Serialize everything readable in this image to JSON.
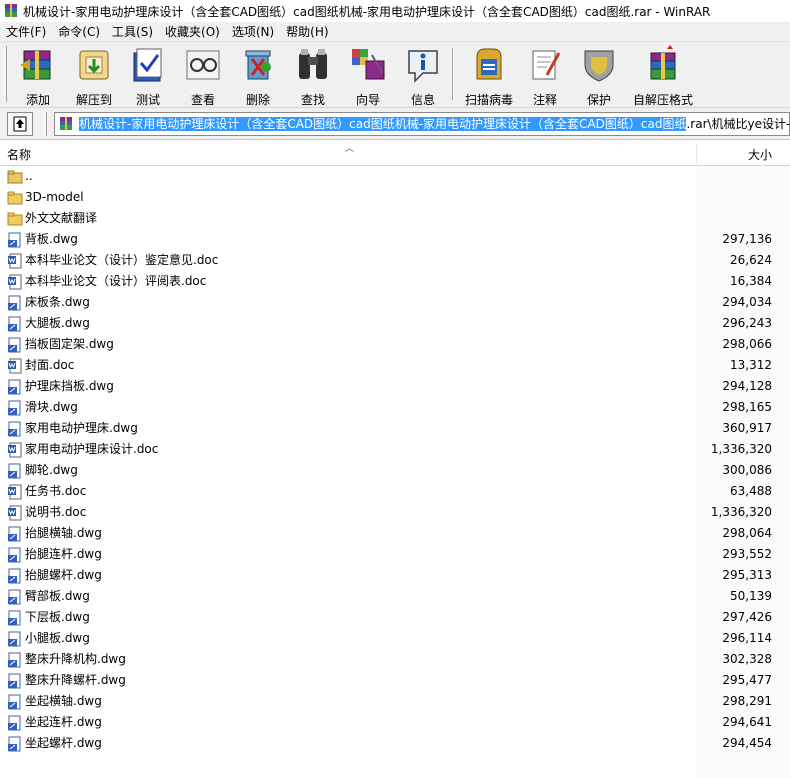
{
  "window": {
    "title": "机械设计-家用电动护理床设计（含全套CAD图纸）cad图纸机械-家用电动护理床设计（含全套CAD图纸）cad图纸.rar - WinRAR"
  },
  "menu": [
    {
      "label": "文件(F)"
    },
    {
      "label": "命令(C)"
    },
    {
      "label": "工具(S)"
    },
    {
      "label": "收藏夹(O)"
    },
    {
      "label": "选项(N)"
    },
    {
      "label": "帮助(H)"
    }
  ],
  "toolbar": [
    {
      "label": "添加",
      "icon": "add-archive-icon"
    },
    {
      "label": "解压到",
      "icon": "extract-to-icon"
    },
    {
      "label": "测试",
      "icon": "test-icon"
    },
    {
      "label": "查看",
      "icon": "view-icon"
    },
    {
      "label": "删除",
      "icon": "delete-icon"
    },
    {
      "label": "查找",
      "icon": "find-icon"
    },
    {
      "label": "向导",
      "icon": "wizard-icon"
    },
    {
      "label": "信息",
      "icon": "info-icon"
    },
    {
      "label": "扫描病毒",
      "icon": "scan-virus-icon"
    },
    {
      "label": "注释",
      "icon": "comment-icon"
    },
    {
      "label": "保护",
      "icon": "protect-icon"
    },
    {
      "label": "自解压格式",
      "icon": "sfx-icon"
    }
  ],
  "address": {
    "selected": "机械设计-家用电动护理床设计（含全套CAD图纸）cad图纸机械-家用电动护理床设计（含全套CAD图纸）cad图纸",
    "rest": ".rar\\机械比ye设计-家"
  },
  "columns": {
    "name": "名称",
    "size": "大小"
  },
  "files": [
    {
      "name": "..",
      "size": "",
      "type": "up"
    },
    {
      "name": "3D-model",
      "size": "",
      "type": "folder"
    },
    {
      "name": "外文文献翻译",
      "size": "",
      "type": "folder"
    },
    {
      "name": "背板.dwg",
      "size": "297,136",
      "type": "dwg"
    },
    {
      "name": "本科毕业论文（设计）鉴定意见.doc",
      "size": "26,624",
      "type": "doc"
    },
    {
      "name": "本科毕业论文（设计）评阅表.doc",
      "size": "16,384",
      "type": "doc"
    },
    {
      "name": "床板条.dwg",
      "size": "294,034",
      "type": "dwg"
    },
    {
      "name": "大腿板.dwg",
      "size": "296,243",
      "type": "dwg"
    },
    {
      "name": "挡板固定架.dwg",
      "size": "298,066",
      "type": "dwg"
    },
    {
      "name": "封面.doc",
      "size": "13,312",
      "type": "doc"
    },
    {
      "name": "护理床挡板.dwg",
      "size": "294,128",
      "type": "dwg"
    },
    {
      "name": "滑块.dwg",
      "size": "298,165",
      "type": "dwg"
    },
    {
      "name": "家用电动护理床.dwg",
      "size": "360,917",
      "type": "dwg"
    },
    {
      "name": "家用电动护理床设计.doc",
      "size": "1,336,320",
      "type": "doc"
    },
    {
      "name": "脚轮.dwg",
      "size": "300,086",
      "type": "dwg"
    },
    {
      "name": "任务书.doc",
      "size": "63,488",
      "type": "doc"
    },
    {
      "name": "说明书.doc",
      "size": "1,336,320",
      "type": "doc"
    },
    {
      "name": "抬腿横轴.dwg",
      "size": "298,064",
      "type": "dwg"
    },
    {
      "name": "抬腿连杆.dwg",
      "size": "293,552",
      "type": "dwg"
    },
    {
      "name": "抬腿螺杆.dwg",
      "size": "295,313",
      "type": "dwg"
    },
    {
      "name": "臂部板.dwg",
      "size": "50,139",
      "type": "dwg"
    },
    {
      "name": "下层板.dwg",
      "size": "297,426",
      "type": "dwg"
    },
    {
      "name": "小腿板.dwg",
      "size": "296,114",
      "type": "dwg"
    },
    {
      "name": "整床升降机构.dwg",
      "size": "302,328",
      "type": "dwg"
    },
    {
      "name": "整床升降螺杆.dwg",
      "size": "295,477",
      "type": "dwg"
    },
    {
      "name": "坐起横轴.dwg",
      "size": "298,291",
      "type": "dwg"
    },
    {
      "name": "坐起连杆.dwg",
      "size": "294,641",
      "type": "dwg"
    },
    {
      "name": "坐起螺杆.dwg",
      "size": "294,454",
      "type": "dwg"
    }
  ]
}
